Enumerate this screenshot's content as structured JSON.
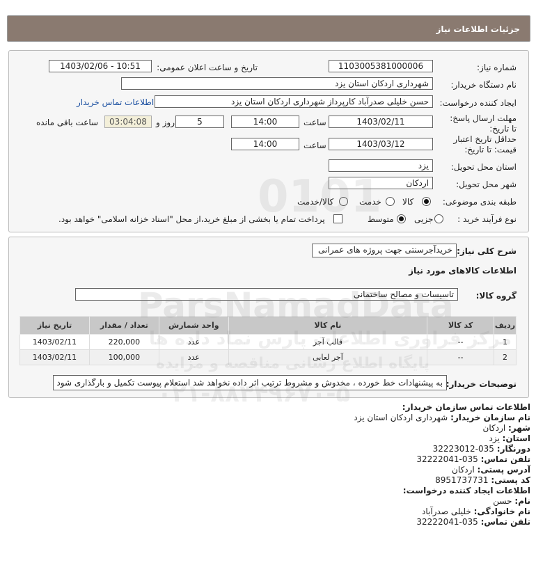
{
  "header": {
    "title": "جزئیات اطلاعات نیاز"
  },
  "form": {
    "need_number_label": "شماره نیاز:",
    "need_number": "1103005381000006",
    "announce_label": "تاریخ و ساعت اعلان عمومی:",
    "announce_value": "1403/02/06 - 10:51",
    "buyer_org_label": "نام دستگاه خریدار:",
    "buyer_org": "شهرداری اردکان استان یزد",
    "creator_label": "ایجاد کننده درخواست:",
    "creator": "حسن خلیلی صدرآباد کارپرداز شهرداری اردکان استان یزد",
    "buyer_contact_link": "اطلاعات تماس خریدار",
    "deadline_label": "مهلت ارسال پاسخ: تا تاریخ:",
    "deadline_date": "1403/02/11",
    "time_label": "ساعت",
    "deadline_time": "14:00",
    "days_value": "5",
    "days_label": "روز و",
    "remaining_time": "03:04:08",
    "remaining_label": "ساعت باقی مانده",
    "validity_label": "حداقل تاریخ اعتبار قیمت: تا تاریخ:",
    "validity_date": "1403/03/12",
    "validity_time": "14:00",
    "province_label": "استان محل تحویل:",
    "province": "یزد",
    "city_label": "شهر محل تحویل:",
    "city": "اردکان",
    "category_label": "طبقه بندی موضوعی:",
    "category_options": [
      "کالا",
      "خدمت",
      "کالا/خدمت"
    ],
    "category_selected": 0,
    "process_label": "نوع فرآیند خرید :",
    "process_options": [
      "جزیی",
      "متوسط"
    ],
    "process_selected": 1,
    "payment_note": "پرداخت تمام یا بخشی از مبلغ خرید،از محل \"اسناد خزانه اسلامی\" خواهد بود."
  },
  "need": {
    "desc_label": "شرح کلی نیاز:",
    "desc": "خریدآجرسنتی جهت پروژه های عمرانی",
    "goods_title": "اطلاعات کالاهای مورد نیاز",
    "group_label": "گروه کالا:",
    "group_value": "تاسیسات و مصالح ساختمانی",
    "table": {
      "headers": [
        "ردیف",
        "کد کالا",
        "نام کالا",
        "واحد شمارش",
        "تعداد / مقدار",
        "تاریخ نیاز"
      ],
      "rows": [
        [
          "1",
          "--",
          "قالب آجر",
          "عدد",
          "220,000",
          "1403/02/11"
        ],
        [
          "2",
          "--",
          "آجر لعابی",
          "عدد",
          "100,000",
          "1403/02/11"
        ]
      ]
    },
    "buyer_notes_label": "توضیحات خریدار:",
    "buyer_notes": "به پیشنهادات خط خورده ، مخدوش و مشروط ترتیب اثر داده نخواهد شد استعلام پیوست تکمیل و بارگذاری شود"
  },
  "contact": {
    "org_title": "اطلاعات تماس سازمان خریدار:",
    "buyer_name_label": "نام سازمان خریدار:",
    "buyer_name": "شهرداری اردکان استان یزد",
    "city_label": "شهر:",
    "city": "اردکان",
    "province_label": "استان:",
    "province": "یزد",
    "fax_label": "دورنگار:",
    "fax": "035-32223012",
    "phone_label": "تلفن تماس:",
    "phone": "035-32222041",
    "address_label": "آدرس پستی:",
    "address": "اردکان",
    "postal_label": "کد پستی:",
    "postal": "8951737731",
    "creator_title": "اطلاعات ایجاد کننده درخواست:",
    "first_name_label": "نام:",
    "first_name": "حسن",
    "last_name_label": "نام خانوادگی:",
    "last_name": "خلیلی صدرآباد",
    "creator_phone_label": "تلفن تماس:",
    "creator_phone": "035-32222041"
  },
  "watermark": {
    "brand": "ParsNamadData",
    "line1": "مرکز فراوری اطلاعات پارس نماد داده ها",
    "line2": "پایگاه اطلاع رسانی مناقصه و مزایده",
    "phone": "۰۲۱-۸۸۳۴۹۶۷۰-۵",
    "numbers": "0101"
  }
}
